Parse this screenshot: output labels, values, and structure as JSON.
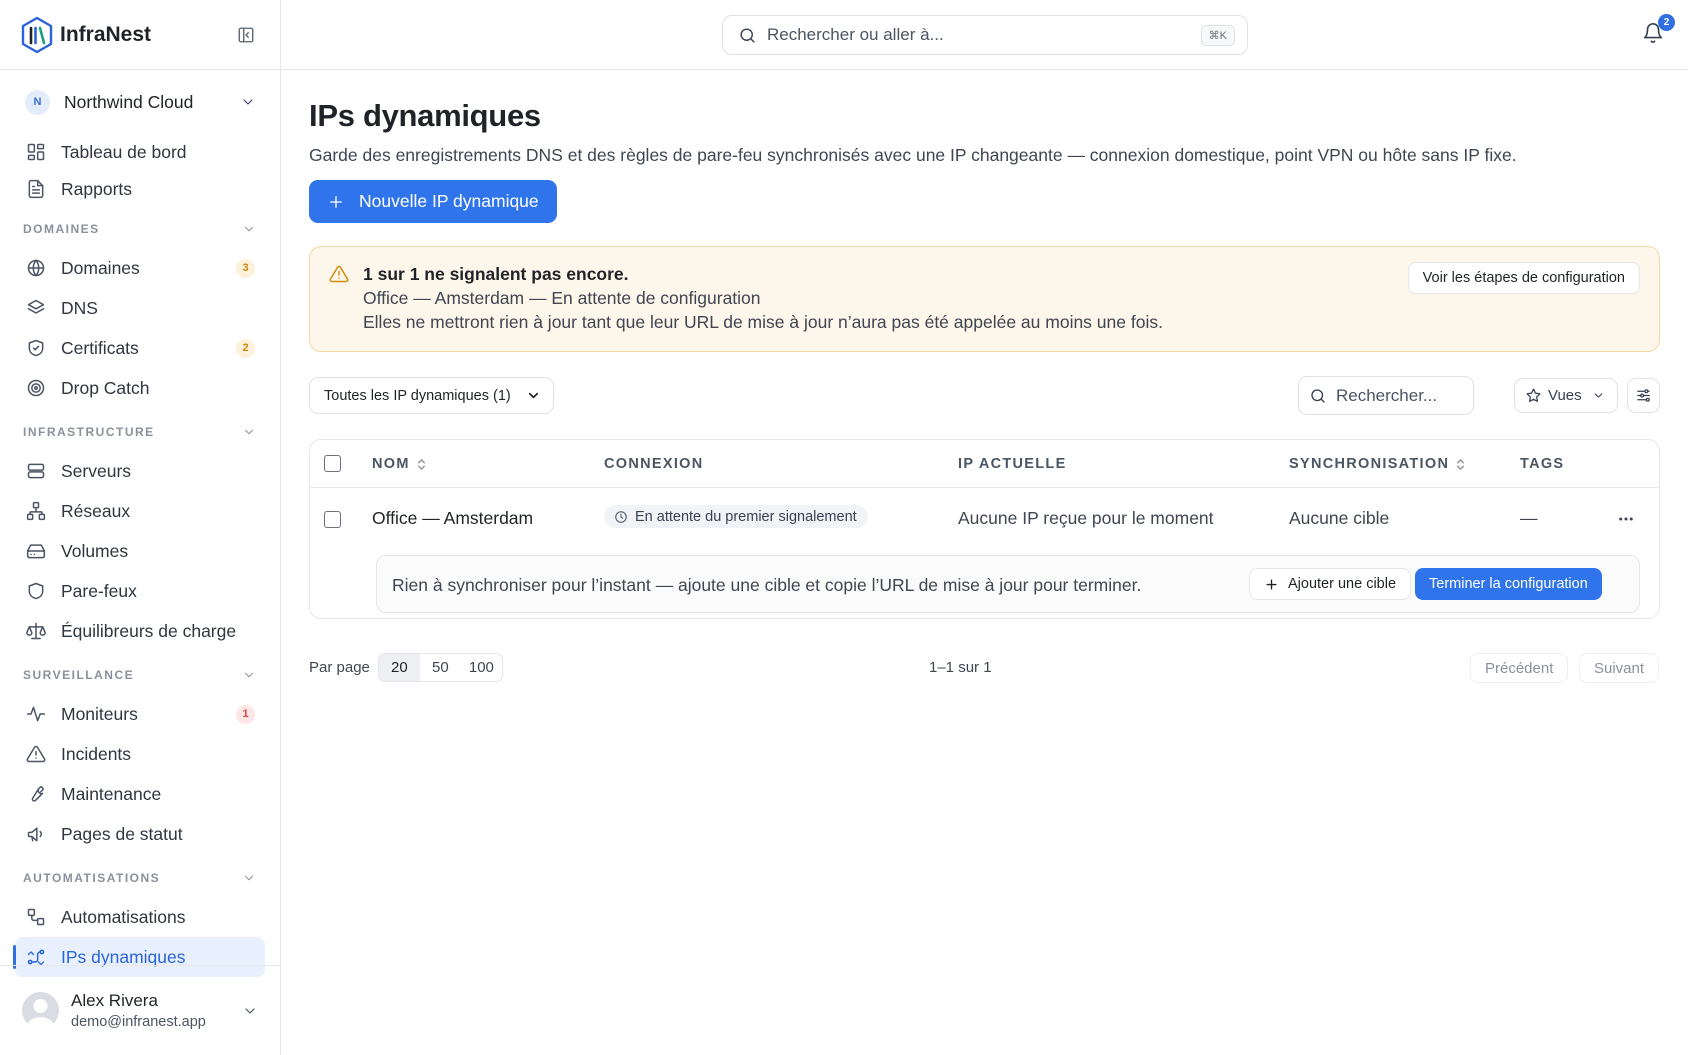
{
  "app": {
    "name": "InfraNest"
  },
  "topbar": {
    "search_placeholder": "Rechercher ou aller à...",
    "search_shortcut": "⌘K",
    "notification_count": "2"
  },
  "sidebar": {
    "org_initial": "N",
    "org_name": "Northwind Cloud",
    "top_items": [
      {
        "label": "Tableau de bord",
        "icon": "dashboard-icon"
      },
      {
        "label": "Rapports",
        "icon": "report-icon"
      }
    ],
    "sections": [
      {
        "title": "DOMAINES",
        "items": [
          {
            "label": "Domaines",
            "icon": "globe-icon",
            "badge": "3"
          },
          {
            "label": "DNS",
            "icon": "layers-icon"
          },
          {
            "label": "Certificats",
            "icon": "shield-check-icon",
            "badge": "2"
          },
          {
            "label": "Drop Catch",
            "icon": "target-icon"
          }
        ]
      },
      {
        "title": "INFRASTRUCTURE",
        "items": [
          {
            "label": "Serveurs",
            "icon": "server-icon"
          },
          {
            "label": "Réseaux",
            "icon": "network-icon"
          },
          {
            "label": "Volumes",
            "icon": "hard-drive-icon"
          },
          {
            "label": "Pare-feux",
            "icon": "shield-icon"
          },
          {
            "label": "Équilibreurs de charge",
            "icon": "scale-icon"
          }
        ]
      },
      {
        "title": "SURVEILLANCE",
        "items": [
          {
            "label": "Moniteurs",
            "icon": "activity-icon",
            "badge": "1"
          },
          {
            "label": "Incidents",
            "icon": "alert-triangle-icon"
          },
          {
            "label": "Maintenance",
            "icon": "wrench-icon"
          },
          {
            "label": "Pages de statut",
            "icon": "megaphone-icon"
          }
        ]
      },
      {
        "title": "AUTOMATISATIONS",
        "items": [
          {
            "label": "Automatisations",
            "icon": "workflow-icon"
          },
          {
            "label": "IPs dynamiques",
            "icon": "dynamic-ip-icon",
            "active": true
          }
        ]
      }
    ],
    "user": {
      "name": "Alex Rivera",
      "email": "demo@infranest.app"
    }
  },
  "page": {
    "title": "IPs dynamiques",
    "description": "Garde des enregistrements DNS et des règles de pare-feu synchronisés avec une IP changeante — connexion domestique, point VPN ou hôte sans IP fixe.",
    "new_button": "Nouvelle IP dynamique"
  },
  "alert": {
    "title": "1 sur 1 ne signalent pas encore.",
    "line1": "Office — Amsterdam — En attente de configuration",
    "line2": "Elles ne mettront rien à jour tant que leur URL de mise à jour n’aura pas été appelée au moins une fois.",
    "button": "Voir les étapes de configuration"
  },
  "toolbar": {
    "filter_value": "Toutes les IP dynamiques (1)",
    "search_placeholder": "Rechercher...",
    "views_label": "Vues"
  },
  "table": {
    "columns": [
      "NOM",
      "CONNEXION",
      "IP ACTUELLE",
      "SYNCHRONISATION",
      "TAGS"
    ],
    "rows": [
      {
        "name": "Office — Amsterdam",
        "connection": "En attente du premier signalement",
        "current_ip": "Aucune IP reçue pour le moment",
        "sync": "Aucune cible",
        "tags": "—"
      }
    ],
    "subrow": {
      "message": "Rien à synchroniser pour l’instant — ajoute une cible et copie l’URL de mise à jour pour terminer.",
      "add_target": "Ajouter une cible",
      "finish": "Terminer la configuration"
    }
  },
  "pagination": {
    "per_page_label": "Par page",
    "options": [
      "20",
      "50",
      "100"
    ],
    "selected": "20",
    "range": "1–1 sur 1",
    "prev": "Précédent",
    "next": "Suivant"
  },
  "colors": {
    "accent": "#2f74ea",
    "warning_bg": "#fdf6ea",
    "warning": "#d18c0e"
  }
}
